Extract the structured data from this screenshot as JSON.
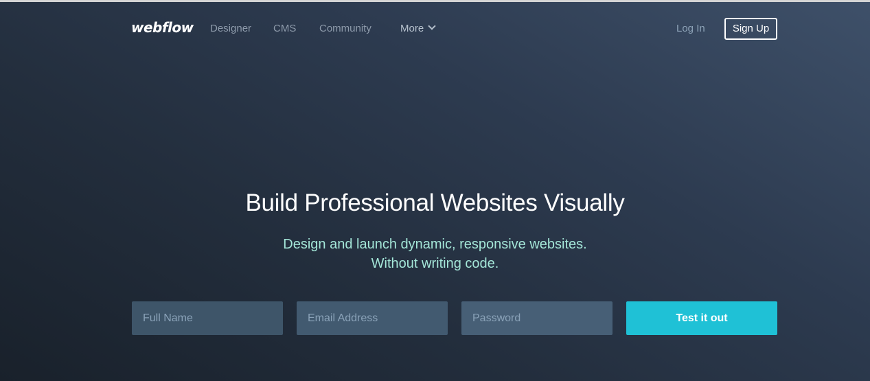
{
  "brand": {
    "logo_text": "webflow"
  },
  "nav": {
    "links": [
      {
        "label": "Designer"
      },
      {
        "label": "CMS"
      },
      {
        "label": "Community"
      },
      {
        "label": "More",
        "icon": "chevron-down-icon"
      }
    ],
    "login_label": "Log In",
    "signup_label": "Sign Up"
  },
  "hero": {
    "headline": "Build Professional Websites Visually",
    "subline_1": "Design and launch dynamic, responsive websites.",
    "subline_2": "Without writing code."
  },
  "form": {
    "full_name_placeholder": "Full Name",
    "email_placeholder": "Email Address",
    "password_placeholder": "Password",
    "full_name_value": "",
    "email_value": "",
    "password_value": "",
    "submit_label": "Test it out"
  },
  "colors": {
    "accent": "#1fc1d6",
    "subtitle": "#a4e6d8",
    "bg_dark": "#19212b",
    "bg_light": "#3e5069"
  }
}
